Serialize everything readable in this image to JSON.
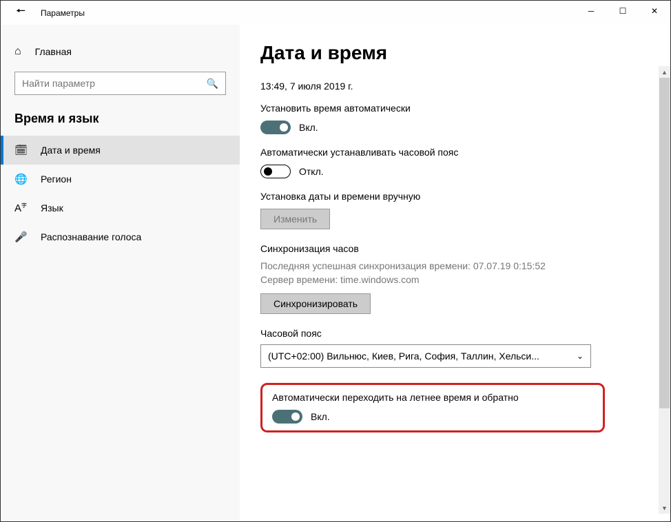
{
  "window": {
    "title": "Параметры"
  },
  "sidebar": {
    "home": "Главная",
    "search_placeholder": "Найти параметр",
    "section": "Время и язык",
    "items": [
      {
        "label": "Дата и время"
      },
      {
        "label": "Регион"
      },
      {
        "label": "Язык"
      },
      {
        "label": "Распознавание голоса"
      }
    ]
  },
  "main": {
    "heading": "Дата и время",
    "now": "13:49, 7 июля 2019 г.",
    "auto_time_label": "Установить время автоматически",
    "auto_time_state": "Вкл.",
    "auto_tz_label": "Автоматически устанавливать часовой пояс",
    "auto_tz_state": "Откл.",
    "manual_label": "Установка даты и времени вручную",
    "change_btn": "Изменить",
    "sync_title": "Синхронизация часов",
    "sync_last": "Последняя успешная синхронизация времени: 07.07.19 0:15:52",
    "sync_server": "Сервер времени: time.windows.com",
    "sync_btn": "Синхронизировать",
    "tz_title": "Часовой пояс",
    "tz_value": "(UTC+02:00) Вильнюс, Киев, Рига, София, Таллин, Хельси...",
    "dst_label": "Автоматически переходить на летнее время и обратно",
    "dst_state": "Вкл."
  }
}
